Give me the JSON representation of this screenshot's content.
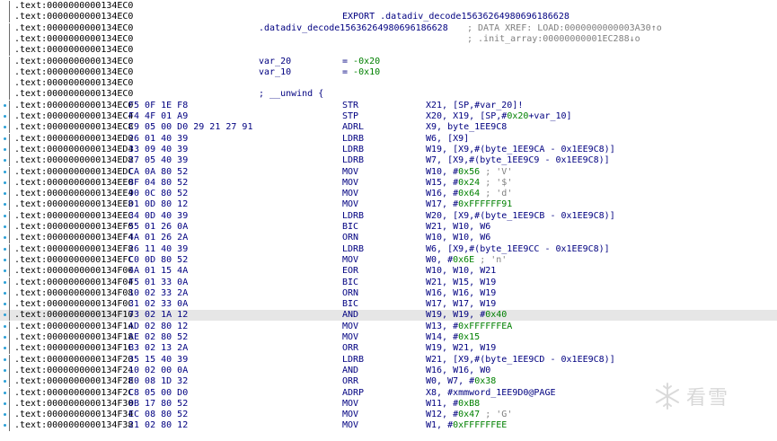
{
  "listing": {
    "lines": [
      {
        "addr": ".text:0000000000134EC0",
        "bytes": "",
        "label": "",
        "mn": "",
        "op": "",
        "com": "",
        "dot": false
      },
      {
        "addr": ".text:0000000000134EC0",
        "bytes": "",
        "label": "",
        "mn": "EXPORT .datadiv_decode15636264980696186628",
        "op": "",
        "com": "",
        "dot": false
      },
      {
        "addr": ".text:0000000000134EC0",
        "bytes": "",
        "label": ".datadiv_decode15636264980696186628",
        "mn": "",
        "op": "",
        "com": "; DATA XREF: LOAD:0000000000003A30↑o",
        "dot": false
      },
      {
        "addr": ".text:0000000000134EC0",
        "bytes": "",
        "label": "",
        "mn": "",
        "op": "",
        "com": "; .init_array:00000000001EC288↓o",
        "dot": false
      },
      {
        "addr": ".text:0000000000134EC0",
        "bytes": "",
        "label": "",
        "mn": "",
        "op": "",
        "com": "",
        "dot": false
      },
      {
        "addr": ".text:0000000000134EC0",
        "bytes": "",
        "label": "var_20",
        "mn": "= -0x20",
        "op": "",
        "com": "",
        "dot": false,
        "var": true
      },
      {
        "addr": ".text:0000000000134EC0",
        "bytes": "",
        "label": "var_10",
        "mn": "= -0x10",
        "op": "",
        "com": "",
        "dot": false,
        "var": true
      },
      {
        "addr": ".text:0000000000134EC0",
        "bytes": "",
        "label": "",
        "mn": "",
        "op": "",
        "com": "",
        "dot": false
      },
      {
        "addr": ".text:0000000000134EC0",
        "bytes": "",
        "label": "; __unwind {",
        "mn": "",
        "op": "",
        "com": "",
        "dot": false
      },
      {
        "addr": ".text:0000000000134EC0",
        "bytes": "F5 0F 1E F8",
        "label": "",
        "mn": "STR",
        "op": "X21, [SP,#var_20]!",
        "com": "",
        "dot": true
      },
      {
        "addr": ".text:0000000000134EC4",
        "bytes": "F4 4F 01 A9",
        "label": "",
        "mn": "STP",
        "op": "X20, X19, [SP,#0x20+var_10]",
        "com": "",
        "dot": true
      },
      {
        "addr": ".text:0000000000134EC8",
        "bytes": "C9 05 00 D0 29 21 27 91",
        "label": "",
        "mn": "ADRL",
        "op": "X9, byte_1EE9C8",
        "com": "",
        "dot": true
      },
      {
        "addr": ".text:0000000000134ED0",
        "bytes": "26 01 40 39",
        "label": "",
        "mn": "LDRB",
        "op": "W6, [X9]",
        "com": "",
        "dot": true
      },
      {
        "addr": ".text:0000000000134ED4",
        "bytes": "33 09 40 39",
        "label": "",
        "mn": "LDRB",
        "op": "W19, [X9,#(byte_1EE9CA - 0x1EE9C8)]",
        "com": "",
        "dot": true
      },
      {
        "addr": ".text:0000000000134ED8",
        "bytes": "27 05 40 39",
        "label": "",
        "mn": "LDRB",
        "op": "W7, [X9,#(byte_1EE9C9 - 0x1EE9C8)]",
        "com": "",
        "dot": true
      },
      {
        "addr": ".text:0000000000134EDC",
        "bytes": "CA 0A 80 52",
        "label": "",
        "mn": "MOV",
        "op": "W10, #0x56 ; 'V'",
        "com": "",
        "dot": true
      },
      {
        "addr": ".text:0000000000134EE0",
        "bytes": "8F 04 80 52",
        "label": "",
        "mn": "MOV",
        "op": "W15, #0x24 ; '$'",
        "com": "",
        "dot": true
      },
      {
        "addr": ".text:0000000000134EE4",
        "bytes": "90 0C 80 52",
        "label": "",
        "mn": "MOV",
        "op": "W16, #0x64 ; 'd'",
        "com": "",
        "dot": true
      },
      {
        "addr": ".text:0000000000134EE8",
        "bytes": "D1 0D 80 12",
        "label": "",
        "mn": "MOV",
        "op": "W17, #0xFFFFFF91",
        "com": "",
        "dot": true
      },
      {
        "addr": ".text:0000000000134EEC",
        "bytes": "34 0D 40 39",
        "label": "",
        "mn": "LDRB",
        "op": "W20, [X9,#(byte_1EE9CB - 0x1EE9C8)]",
        "com": "",
        "dot": true
      },
      {
        "addr": ".text:0000000000134EF0",
        "bytes": "55 01 26 0A",
        "label": "",
        "mn": "BIC",
        "op": "W21, W10, W6",
        "com": "",
        "dot": true
      },
      {
        "addr": ".text:0000000000134EF4",
        "bytes": "4A 01 26 2A",
        "label": "",
        "mn": "ORN",
        "op": "W10, W10, W6",
        "com": "",
        "dot": true
      },
      {
        "addr": ".text:0000000000134EF8",
        "bytes": "26 11 40 39",
        "label": "",
        "mn": "LDRB",
        "op": "W6, [X9,#(byte_1EE9CC - 0x1EE9C8)]",
        "com": "",
        "dot": true
      },
      {
        "addr": ".text:0000000000134EFC",
        "bytes": "C0 0D 80 52",
        "label": "",
        "mn": "MOV",
        "op": "W0, #0x6E ; 'n'",
        "com": "",
        "dot": true
      },
      {
        "addr": ".text:0000000000134F00",
        "bytes": "4A 01 15 4A",
        "label": "",
        "mn": "EOR",
        "op": "W10, W10, W21",
        "com": "",
        "dot": true
      },
      {
        "addr": ".text:0000000000134F04",
        "bytes": "F5 01 33 0A",
        "label": "",
        "mn": "BIC",
        "op": "W21, W15, W19",
        "com": "",
        "dot": true
      },
      {
        "addr": ".text:0000000000134F08",
        "bytes": "10 02 33 2A",
        "label": "",
        "mn": "ORN",
        "op": "W16, W16, W19",
        "com": "",
        "dot": true
      },
      {
        "addr": ".text:0000000000134F0C",
        "bytes": "31 02 33 0A",
        "label": "",
        "mn": "BIC",
        "op": "W17, W17, W19",
        "com": "",
        "dot": true
      },
      {
        "addr": ".text:0000000000134F10",
        "bytes": "73 02 1A 12",
        "label": "",
        "mn": "AND",
        "op": "W19, W19, #0x40",
        "com": "",
        "dot": true,
        "hl": true
      },
      {
        "addr": ".text:0000000000134F14",
        "bytes": "AD 02 80 12",
        "label": "",
        "mn": "MOV",
        "op": "W13, #0xFFFFFFEA",
        "com": "",
        "dot": true
      },
      {
        "addr": ".text:0000000000134F18",
        "bytes": "AE 02 80 52",
        "label": "",
        "mn": "MOV",
        "op": "W14, #0x15",
        "com": "",
        "dot": true
      },
      {
        "addr": ".text:0000000000134F1C",
        "bytes": "B3 02 13 2A",
        "label": "",
        "mn": "ORR",
        "op": "W19, W21, W19",
        "com": "",
        "dot": true
      },
      {
        "addr": ".text:0000000000134F20",
        "bytes": "35 15 40 39",
        "label": "",
        "mn": "LDRB",
        "op": "W21, [X9,#(byte_1EE9CD - 0x1EE9C8)]",
        "com": "",
        "dot": true
      },
      {
        "addr": ".text:0000000000134F24",
        "bytes": "10 02 00 0A",
        "label": "",
        "mn": "AND",
        "op": "W16, W16, W0",
        "com": "",
        "dot": true
      },
      {
        "addr": ".text:0000000000134F28",
        "bytes": "E0 08 1D 32",
        "label": "",
        "mn": "ORR",
        "op": "W0, W7, #0x38",
        "com": "",
        "dot": true
      },
      {
        "addr": ".text:0000000000134F2C",
        "bytes": "C8 05 00 D0",
        "label": "",
        "mn": "ADRP",
        "op": "X8, #xmmword_1EE9D0@PAGE",
        "com": "",
        "dot": true
      },
      {
        "addr": ".text:0000000000134F30",
        "bytes": "0B 17 80 52",
        "label": "",
        "mn": "MOV",
        "op": "W11, #0xB8",
        "com": "",
        "dot": true
      },
      {
        "addr": ".text:0000000000134F34",
        "bytes": "EC 08 80 52",
        "label": "",
        "mn": "MOV",
        "op": "W12, #0x47 ; 'G'",
        "com": "",
        "dot": true
      },
      {
        "addr": ".text:0000000000134F38",
        "bytes": "21 02 80 12",
        "label": "",
        "mn": "MOV",
        "op": "W1, #0xFFFFFFEE",
        "com": "",
        "dot": true
      }
    ]
  },
  "watermark": {
    "text": "看雪",
    "icon": "snowflake-icon"
  },
  "colors": {
    "address": "#000000",
    "code": "#000080",
    "number": "#008000",
    "comment": "#7f7f7f",
    "highlight": "#e6e6e6",
    "breakpoint_dot": "#2a9fd6"
  }
}
